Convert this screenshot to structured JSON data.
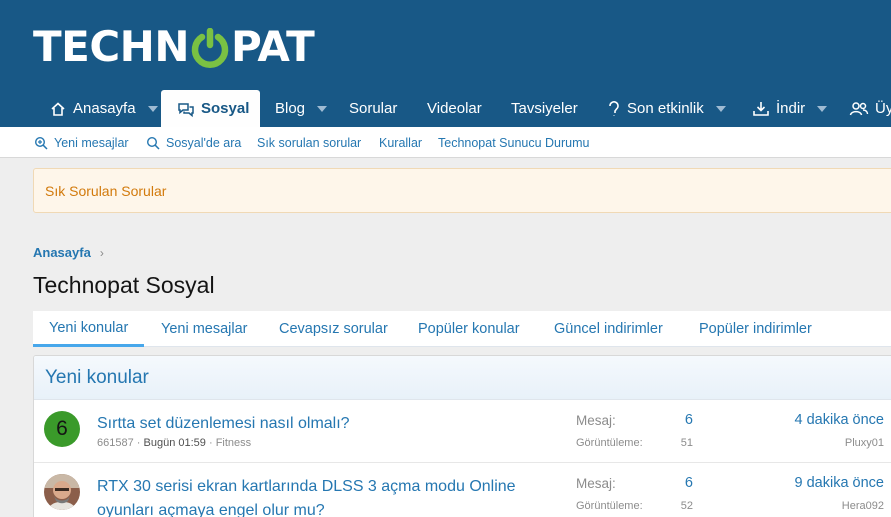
{
  "logo": {
    "part1": "TECHN",
    "part2": "PAT",
    "accent": "#7ac143"
  },
  "nav": {
    "items": [
      {
        "label": "Anasayfa",
        "icon": "home-icon",
        "caret": true
      },
      {
        "label": "Sosyal",
        "icon": "chat-icon",
        "caret": false,
        "active": true
      },
      {
        "label": "Blog",
        "icon": "",
        "caret": true
      },
      {
        "label": "Sorular",
        "icon": "",
        "caret": false
      },
      {
        "label": "Videolar",
        "icon": "",
        "caret": false
      },
      {
        "label": "Tavsiyeler",
        "icon": "",
        "caret": false
      },
      {
        "label": "Son etkinlik",
        "icon": "bulb-icon",
        "caret": true
      },
      {
        "label": "İndir",
        "icon": "download-icon",
        "caret": true
      },
      {
        "label": "Üy",
        "icon": "users-icon",
        "caret": false
      }
    ]
  },
  "subnav": {
    "items": [
      {
        "label": "Yeni mesajlar",
        "icon": "zoom-icon"
      },
      {
        "label": "Sosyal'de ara",
        "icon": "search-icon"
      },
      {
        "label": "Sık sorulan sorular"
      },
      {
        "label": "Kurallar"
      },
      {
        "label": "Technopat Sunucu Durumu"
      }
    ]
  },
  "notice": "Sık Sorulan Sorular",
  "breadcrumb": {
    "label": "Anasayfa",
    "sep": "›"
  },
  "page_title": "Technopat Sosyal",
  "tabs": [
    "Yeni konular",
    "Yeni mesajlar",
    "Cevapsız sorular",
    "Popüler konular",
    "Güncel indirimler",
    "Popüler indirimler"
  ],
  "block": {
    "title": "Yeni konular",
    "labels": {
      "replies": "Mesaj:",
      "views": "Görüntüleme:"
    },
    "threads": [
      {
        "avatar_letter": "6",
        "title": "Sırtta set düzenlemesi nasıl olmalı?",
        "author": "661587",
        "sep": "·",
        "date": "Bugün 01:59",
        "forum": "Fitness",
        "replies": "6",
        "views": "51",
        "last_time": "4 dakika önce",
        "last_user": "Pluxy01"
      },
      {
        "avatar_letter": "",
        "title": "RTX 30 serisi ekran kartlarında DLSS 3 açma modu Online oyunları açmaya engel olur mu?",
        "author": "",
        "sep": "",
        "date": "",
        "forum": "",
        "replies": "6",
        "views": "52",
        "last_time": "9 dakika önce",
        "last_user": "Hera092"
      }
    ]
  }
}
